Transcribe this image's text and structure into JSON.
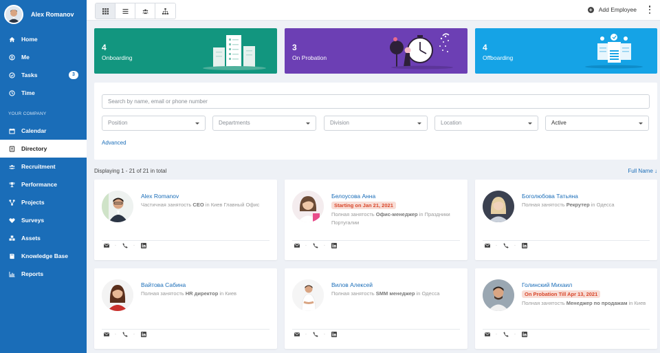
{
  "sidebar": {
    "user_name": "Alex Romanov",
    "items_top": [
      {
        "label": "Home",
        "icon": "home-icon"
      },
      {
        "label": "Me",
        "icon": "user-icon"
      },
      {
        "label": "Tasks",
        "icon": "check-circle-icon",
        "badge": "3"
      },
      {
        "label": "Time",
        "icon": "clock-icon"
      }
    ],
    "section_label": "YOUR COMPANY",
    "items_company": [
      {
        "label": "Calendar",
        "icon": "calendar-icon"
      },
      {
        "label": "Directory",
        "icon": "address-book-icon",
        "active": true
      },
      {
        "label": "Recruitment",
        "icon": "users-icon"
      },
      {
        "label": "Performance",
        "icon": "trophy-icon"
      },
      {
        "label": "Projects",
        "icon": "sitemap-icon"
      },
      {
        "label": "Surveys",
        "icon": "heart-icon"
      },
      {
        "label": "Assets",
        "icon": "cubes-icon"
      },
      {
        "label": "Knowledge Base",
        "icon": "book-icon"
      },
      {
        "label": "Reports",
        "icon": "bar-chart-icon"
      }
    ]
  },
  "topbar": {
    "view_buttons": [
      "grid-view-icon",
      "list-view-icon",
      "team-view-icon",
      "org-chart-icon"
    ],
    "add_employee": "Add Employee"
  },
  "stats": [
    {
      "count": "4",
      "label": "Onboarding",
      "color": "#12967f"
    },
    {
      "count": "3",
      "label": "On Probation",
      "color": "#6c3fb4"
    },
    {
      "count": "4",
      "label": "Offboarding",
      "color": "#15a3e6"
    }
  ],
  "filters": {
    "search_placeholder": "Search by name, email or phone number",
    "position": "Position",
    "departments": "Departments",
    "division": "Division",
    "location": "Location",
    "status": "Active",
    "advanced": "Advanced"
  },
  "listing": {
    "displaying": "Displaying 1 - 21 of 21 in total",
    "sort": "Full Name ↓"
  },
  "employees": [
    {
      "name": "Alex Romanov",
      "badge": "",
      "desc_pre": "Частичная занятость ",
      "role": "CEO",
      "desc_post": " in Киев Главный Офис"
    },
    {
      "name": "Белоусова Анна",
      "badge": "Starting on Jan 21, 2021",
      "desc_pre": "Полная занятость ",
      "role": "Офис-менеджер",
      "desc_post": " in Праздники Португалии"
    },
    {
      "name": "Боголюбова Татьяна",
      "badge": "",
      "desc_pre": "Полная занятость ",
      "role": "Рекрутер",
      "desc_post": " in Одесса"
    },
    {
      "name": "Вайтова Сабина",
      "badge": "",
      "desc_pre": "Полная занятость ",
      "role": "HR директор",
      "desc_post": " in Киев"
    },
    {
      "name": "Вилов Алексей",
      "badge": "",
      "desc_pre": "Полная занятость ",
      "role": "SMM менеджер",
      "desc_post": " in Одесса"
    },
    {
      "name": "Голинский Михаил",
      "badge": "On Probation Till Apr 13, 2021",
      "desc_pre": "Полная занятость ",
      "role": "Менеджер по продажам",
      "desc_post": " in Киев"
    }
  ]
}
